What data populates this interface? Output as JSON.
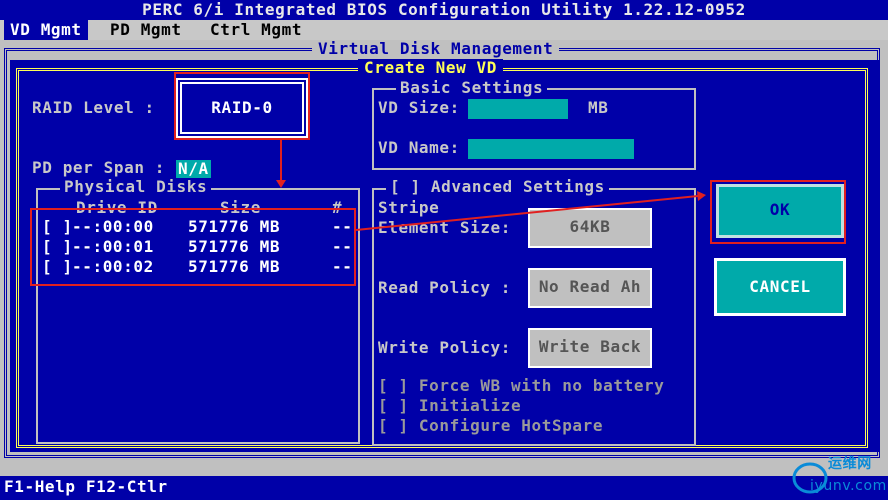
{
  "title": "PERC 6/i Integrated BIOS Configuration Utility 1.22.12-0952",
  "menu": [
    "VD Mgmt",
    "PD Mgmt",
    "Ctrl Mgmt"
  ],
  "outer_panel_title": "Virtual Disk Management",
  "dialog": {
    "title": "Create New VD",
    "raid_level_label": "RAID Level :",
    "raid_level_value": "RAID-0",
    "pd_per_span_label": "PD per Span :",
    "pd_per_span_value": "N/A",
    "physical_disks": {
      "title": "Physical Disks",
      "col_drive": "Drive ID",
      "col_size": "Size",
      "col_num": "#",
      "rows": [
        {
          "check": "[ ]",
          "drive": "--:00:00",
          "size": "571776 MB",
          "num": "--"
        },
        {
          "check": "[ ]",
          "drive": "--:00:01",
          "size": "571776 MB",
          "num": "--"
        },
        {
          "check": "[ ]",
          "drive": "--:00:02",
          "size": "571776 MB",
          "num": "--"
        }
      ]
    },
    "basic_settings": {
      "title": "Basic Settings",
      "vd_size_label": "VD Size:",
      "vd_size_unit": "MB",
      "vd_name_label": "VD Name:"
    },
    "advanced_settings": {
      "title": "[ ] Advanced Settings",
      "stripe_label_1": "Stripe",
      "stripe_label_2": "Element Size:",
      "stripe_value": "64KB",
      "read_policy_label": "Read Policy :",
      "read_policy_value": "No Read Ah",
      "write_policy_label": "Write Policy:",
      "write_policy_value": "Write Back",
      "options": [
        "[ ] Force WB with no battery",
        "[ ] Initialize",
        "[ ] Configure HotSpare"
      ]
    },
    "ok_label": "OK",
    "cancel_label": "CANCEL"
  },
  "status_bar": "F1-Help F12-Ctlr",
  "watermark": {
    "title": "运维网",
    "url": "iyunv.com"
  },
  "colors": {
    "bios_blue": "#0000a8",
    "panel_gray": "#c0c0c0",
    "cyan": "#00aaaa",
    "yellow": "#ffff55",
    "annotation_red": "#e02020"
  }
}
